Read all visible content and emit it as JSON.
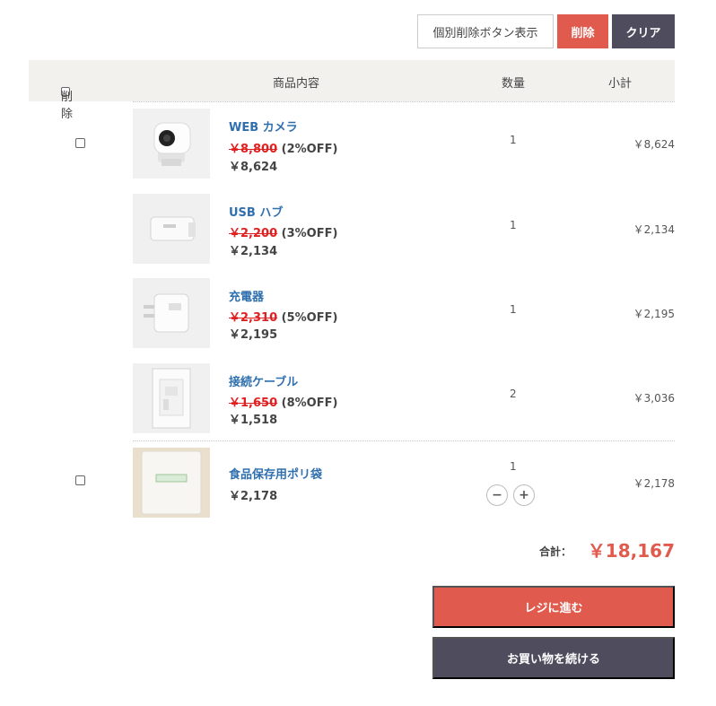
{
  "actions": {
    "toggle_label": "個別削除ボタン表示",
    "delete_label": "削除",
    "clear_label": "クリア"
  },
  "table_head": {
    "delete": "削除",
    "item": "商品内容",
    "qty": "数量",
    "subtotal": "小計"
  },
  "items": [
    {
      "name": "WEB カメラ",
      "orig_price": "￥8,800",
      "discount": " (2%OFF)",
      "price": "￥8,624",
      "qty": "1",
      "subtotal": "￥8,624"
    },
    {
      "name": "USB ハブ",
      "orig_price": "￥2,200",
      "discount": " (3%OFF)",
      "price": "￥2,134",
      "qty": "1",
      "subtotal": "￥2,134"
    },
    {
      "name": "充電器",
      "orig_price": "￥2,310",
      "discount": " (5%OFF)",
      "price": "￥2,195",
      "qty": "1",
      "subtotal": "￥2,195"
    },
    {
      "name": "接続ケーブル",
      "orig_price": "￥1,650",
      "discount": " (8%OFF)",
      "price": "￥1,518",
      "qty": "2",
      "subtotal": "￥3,036"
    },
    {
      "name": "食品保存用ポリ袋",
      "price": "￥2,178",
      "qty": "1",
      "subtotal": "￥2,178"
    }
  ],
  "stepper": {
    "minus": "−",
    "plus": "+"
  },
  "total": {
    "label": "合計：",
    "value": "￥18,167"
  },
  "buttons": {
    "checkout": "レジに進む",
    "continue": "お買い物を続ける"
  },
  "colors": {
    "accent": "#e05a4e",
    "dark": "#4f4c5d",
    "link": "#2f6fae",
    "header_bg": "#f3f1ee"
  }
}
